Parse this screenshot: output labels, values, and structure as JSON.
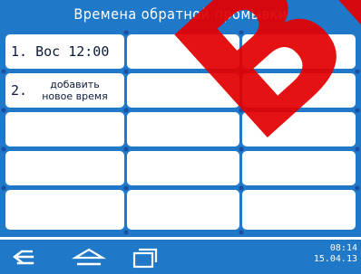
{
  "header": {
    "title": "Времена обратной промывки"
  },
  "schedule": {
    "row1": {
      "label": "1.  Вос 12:00"
    },
    "row2": {
      "number": "2.",
      "add_label": "добавить\nновое время"
    }
  },
  "status_bar": {
    "time": "08:14",
    "date": "15.04.13"
  },
  "navigation": {
    "icons": [
      "back-icon",
      "home-icon",
      "recent-apps-icon"
    ]
  },
  "watermark": {
    "text": "ВЫ"
  },
  "colors": {
    "accent": "#1f78c8",
    "cell": "#ffffff",
    "watermark": "#e20000",
    "text": "#0b1a3a"
  }
}
